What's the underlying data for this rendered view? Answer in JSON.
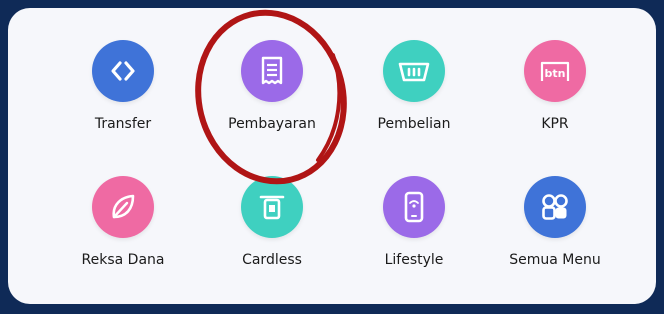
{
  "menu": {
    "items": [
      {
        "label": "Transfer",
        "icon": "transfer-arrows-icon",
        "color": "#3f73d8"
      },
      {
        "label": "Pembayaran",
        "icon": "receipt-icon",
        "color": "#9b6ae8"
      },
      {
        "label": "Pembelian",
        "icon": "basket-icon",
        "color": "#3fd0c0"
      },
      {
        "label": "KPR",
        "icon": "btn-house-icon",
        "color": "#ef6aa3"
      },
      {
        "label": "Reksa Dana",
        "icon": "leaf-icon",
        "color": "#ef6aa3"
      },
      {
        "label": "Cardless",
        "icon": "card-slot-icon",
        "color": "#3fd0c0"
      },
      {
        "label": "Lifestyle",
        "icon": "phone-icon",
        "color": "#9b6ae8"
      },
      {
        "label": "Semua Menu",
        "icon": "all-menu-grid-icon",
        "color": "#3f73d8"
      }
    ]
  },
  "kpr_icon_text": "btn",
  "annotation": {
    "highlight_color": "#b01515",
    "highlighted_item": "Pembayaran"
  },
  "colors": {
    "background": "#0f2a57",
    "card": "#f6f7fb"
  }
}
